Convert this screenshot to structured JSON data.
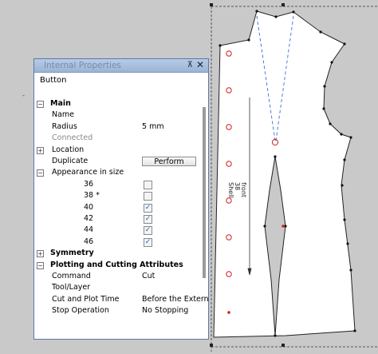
{
  "panel": {
    "title": "Internal Properties",
    "pin_icon": "pin-icon",
    "close_icon": "close-icon",
    "object_type": "Button"
  },
  "properties": [
    {
      "label": "Main",
      "kind": "group",
      "expander": "-"
    },
    {
      "label": "Name",
      "kind": "prop",
      "value": ""
    },
    {
      "label": "Radius",
      "kind": "prop",
      "value": "5 mm"
    },
    {
      "label": "Connected",
      "kind": "prop-disabled",
      "value": ""
    },
    {
      "label": "Location",
      "kind": "subgroup",
      "expander": "+"
    },
    {
      "label": "Duplicate",
      "kind": "button",
      "value": "Perform"
    },
    {
      "label": "Appearance in size",
      "kind": "subgroup",
      "expander": "-"
    },
    {
      "label": "36",
      "kind": "size",
      "checked": false
    },
    {
      "label": "38 *",
      "kind": "size",
      "checked": false
    },
    {
      "label": "40",
      "kind": "size",
      "checked": true
    },
    {
      "label": "42",
      "kind": "size",
      "checked": true
    },
    {
      "label": "44",
      "kind": "size",
      "checked": true
    },
    {
      "label": "46",
      "kind": "size",
      "checked": true
    },
    {
      "label": "Symmetry",
      "kind": "group",
      "expander": "+"
    },
    {
      "label": "Plotting and Cutting Attributes",
      "kind": "group",
      "expander": "-"
    },
    {
      "label": "Command",
      "kind": "prop",
      "value": "Cut"
    },
    {
      "label": "Tool/Layer",
      "kind": "prop",
      "value": ""
    },
    {
      "label": "Cut and Plot Time",
      "kind": "prop",
      "value": "Before the Extern"
    },
    {
      "label": "Stop Operation",
      "kind": "prop",
      "value": "No Stopping"
    }
  ],
  "canvas": {
    "piece_label": [
      "front",
      "38",
      "Shell"
    ],
    "colors": {
      "background": "#c9c9c9",
      "piece": "#ffffff",
      "outline": "#222222",
      "dart_guide": "#3b6fd6",
      "button": "#d02020"
    }
  }
}
